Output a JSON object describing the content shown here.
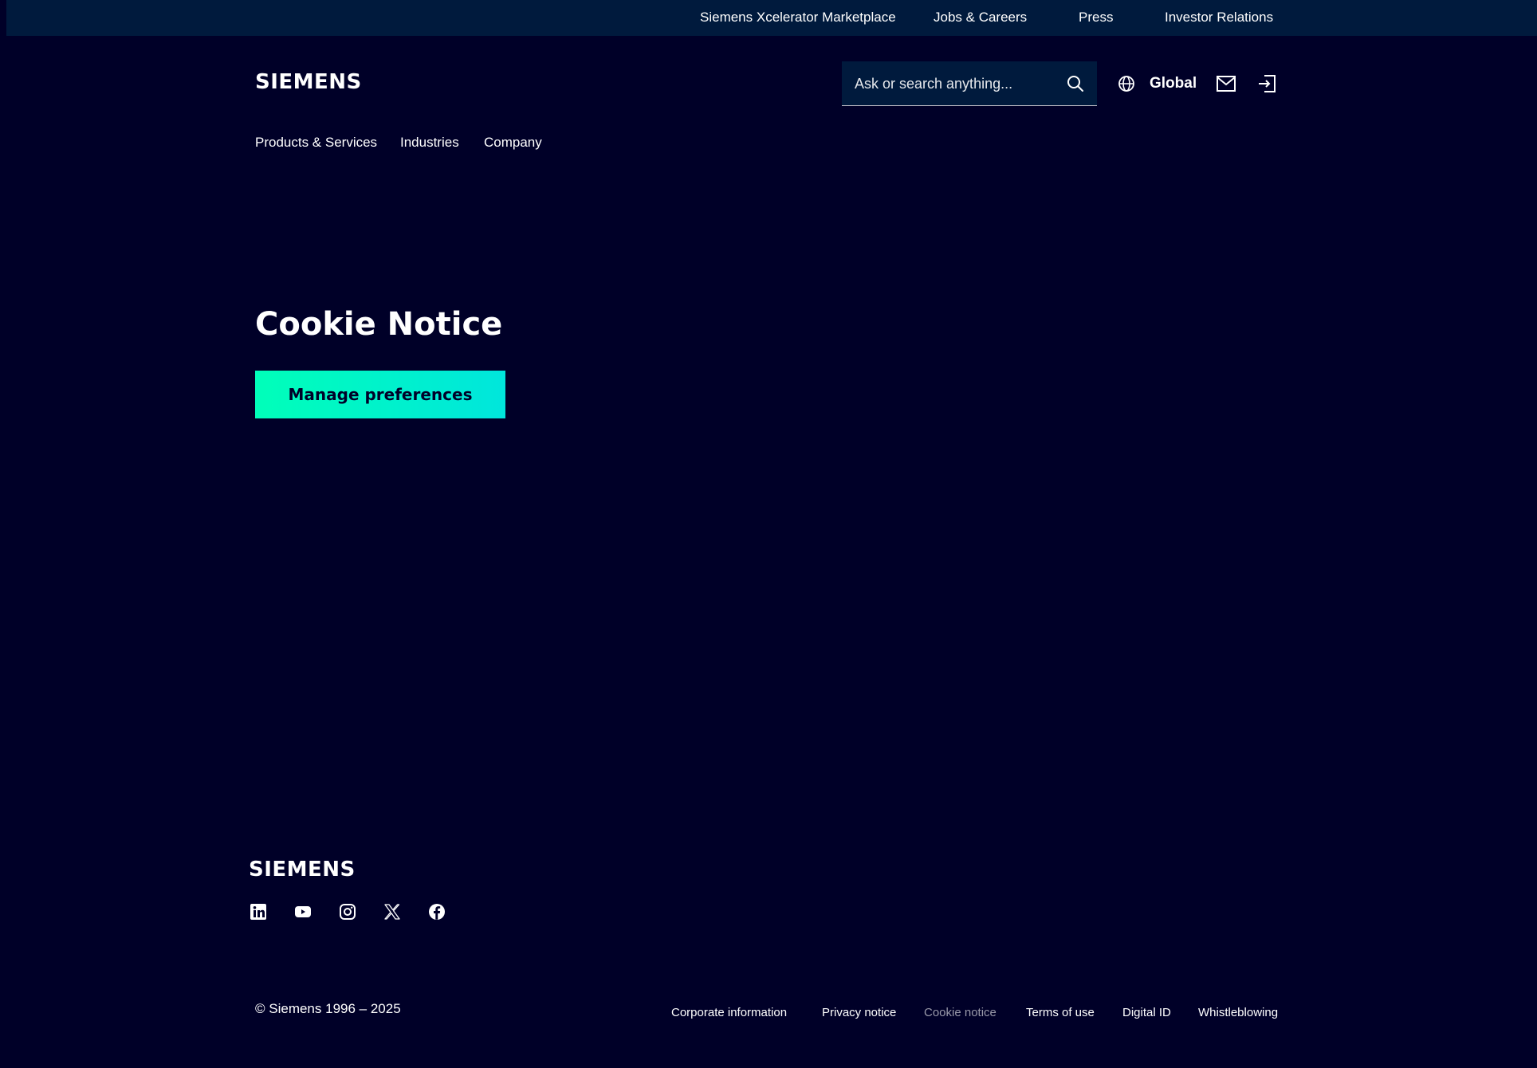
{
  "topbar": {
    "links": [
      "Siemens Xcelerator Marketplace",
      "Jobs & Careers",
      "Press",
      "Investor Relations"
    ]
  },
  "header": {
    "logo_text": "SIEMENS",
    "search": {
      "placeholder": "Ask or search anything...",
      "value": ""
    },
    "region_label": "Global",
    "icons": [
      "globe-icon",
      "mail-icon",
      "login-icon",
      "search-icon"
    ]
  },
  "nav": {
    "items": [
      "Products & Services",
      "Industries",
      "Company"
    ]
  },
  "main": {
    "title": "Cookie Notice",
    "button_label": "Manage preferences"
  },
  "footer": {
    "logo_text": "SIEMENS",
    "social_icons": [
      "linkedin-icon",
      "youtube-icon",
      "instagram-icon",
      "x-icon",
      "facebook-icon"
    ],
    "copyright": "© Siemens 1996 – 2025",
    "links": [
      "Corporate information",
      "Privacy notice",
      "Cookie notice",
      "Terms of use",
      "Digital ID",
      "Whistleblowing"
    ]
  },
  "colors": {
    "background": "#000028",
    "topbar": "#001a3d",
    "accent_gradient_start": "#00ffb9",
    "accent_gradient_end": "#00e6dc",
    "muted_link": "#9999a9"
  }
}
